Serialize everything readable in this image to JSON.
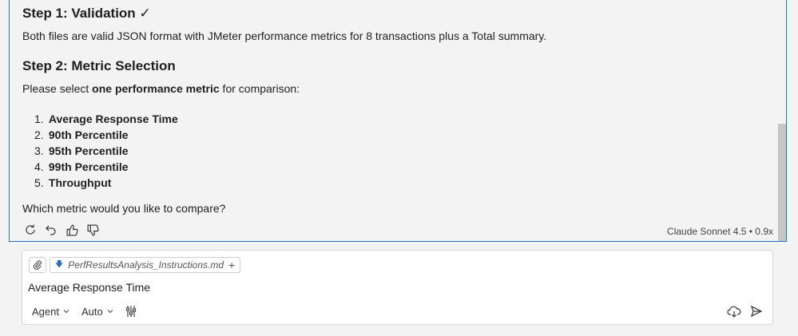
{
  "response": {
    "step1_heading": "Step 1: Validation ✓",
    "step1_text": "Both files are valid JSON format with JMeter performance metrics for 8 transactions plus a Total summary.",
    "step2_heading": "Step 2: Metric Selection",
    "select_prefix": "Please select ",
    "select_bold": "one performance metric",
    "select_suffix": " for comparison:",
    "metrics": [
      {
        "num": "1.",
        "label": "Average Response Time"
      },
      {
        "num": "2.",
        "label": "90th Percentile"
      },
      {
        "num": "3.",
        "label": "95th Percentile"
      },
      {
        "num": "4.",
        "label": "99th Percentile"
      },
      {
        "num": "5.",
        "label": "Throughput"
      }
    ],
    "question": "Which metric would you like to compare?",
    "model_label": "Claude Sonnet 4.5 • 0.9x"
  },
  "actions": {
    "icons": [
      "retry-icon",
      "undo-icon",
      "thumbs-up-icon",
      "thumbs-down-icon"
    ]
  },
  "input": {
    "file_chip": "PerfResultsAnalysis_Instructions.md",
    "value": "Average Response Time",
    "mode": "Agent",
    "model": "Auto"
  },
  "colors": {
    "accent_border": "#1a73c7",
    "background": "#f3f3f3"
  }
}
